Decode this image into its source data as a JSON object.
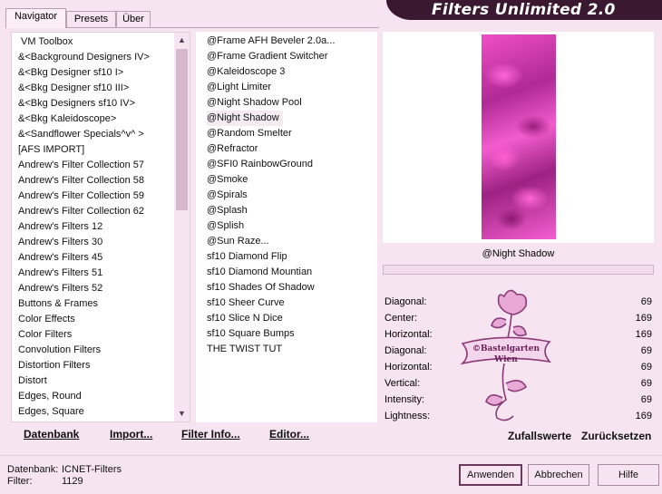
{
  "title": "Filters Unlimited 2.0",
  "tabs": [
    {
      "label": "Navigator"
    },
    {
      "label": "Presets"
    },
    {
      "label": "Über"
    }
  ],
  "categories": [
    "VM Toolbox",
    "&<Background Designers IV>",
    "&<Bkg Designer sf10 I>",
    "&<Bkg Designer sf10 III>",
    "&<Bkg Designers sf10 IV>",
    "&<Bkg Kaleidoscope>",
    "&<Sandflower Specials^v^ >",
    "[AFS IMPORT]",
    "Andrew's Filter Collection 57",
    "Andrew's Filter Collection 58",
    "Andrew's Filter Collection 59",
    "Andrew's Filter Collection 62",
    "Andrew's Filters 12",
    "Andrew's Filters 30",
    "Andrew's Filters 45",
    "Andrew's Filters 51",
    "Andrew's Filters 52",
    "Buttons & Frames",
    "Color Effects",
    "Color Filters",
    "Convolution Filters",
    "Distortion Filters",
    "Distort",
    "Edges, Round",
    "Edges, Square"
  ],
  "filters": [
    "@Frame AFH Beveler 2.0a...",
    "@Frame Gradient Switcher",
    "@Kaleidoscope 3",
    "@Light Limiter",
    "@Night Shadow Pool",
    "@Night Shadow",
    "@Random Smelter",
    "@Refractor",
    "@SFI0 RainbowGround",
    "@Smoke",
    "@Spirals",
    "@Splash",
    "@Splish",
    "@Sun Raze...",
    "sf10 Diamond Flip",
    "sf10 Diamond Mountian",
    "sf10 Shades Of Shadow",
    "sf10 Sheer Curve",
    "sf10 Slice N Dice",
    "sf10 Square Bumps",
    "THE TWIST TUT"
  ],
  "bottom_buttons": {
    "datenbank": "Datenbank",
    "import": "Import...",
    "filter_info": "Filter Info...",
    "editor": "Editor..."
  },
  "selected_filter": "@Night Shadow",
  "params": [
    {
      "label": "Diagonal:",
      "value": "69"
    },
    {
      "label": "Center:",
      "value": "169"
    },
    {
      "label": "Horizontal:",
      "value": "169"
    },
    {
      "label": "Diagonal:",
      "value": "69"
    },
    {
      "label": "Horizontal:",
      "value": "69"
    },
    {
      "label": "Vertical:",
      "value": "69"
    },
    {
      "label": "Intensity:",
      "value": "69"
    },
    {
      "label": "Lightness:",
      "value": "169"
    }
  ],
  "right_buttons": {
    "random": "Zufallswerte",
    "reset": "Zurücksetzen"
  },
  "watermark_text": "©Bastelgarten Wien",
  "status": {
    "db_label": "Datenbank:",
    "db_value": "ICNET-Filters",
    "filter_label": "Filter:",
    "filter_value": "1129"
  },
  "dialog_buttons": {
    "apply": "Anwenden",
    "cancel": "Abbrechen",
    "help": "Hilfe"
  },
  "colors": {
    "background": "#f6e4f0",
    "banner": "#3a1830",
    "accent": "#d6b8cc"
  }
}
